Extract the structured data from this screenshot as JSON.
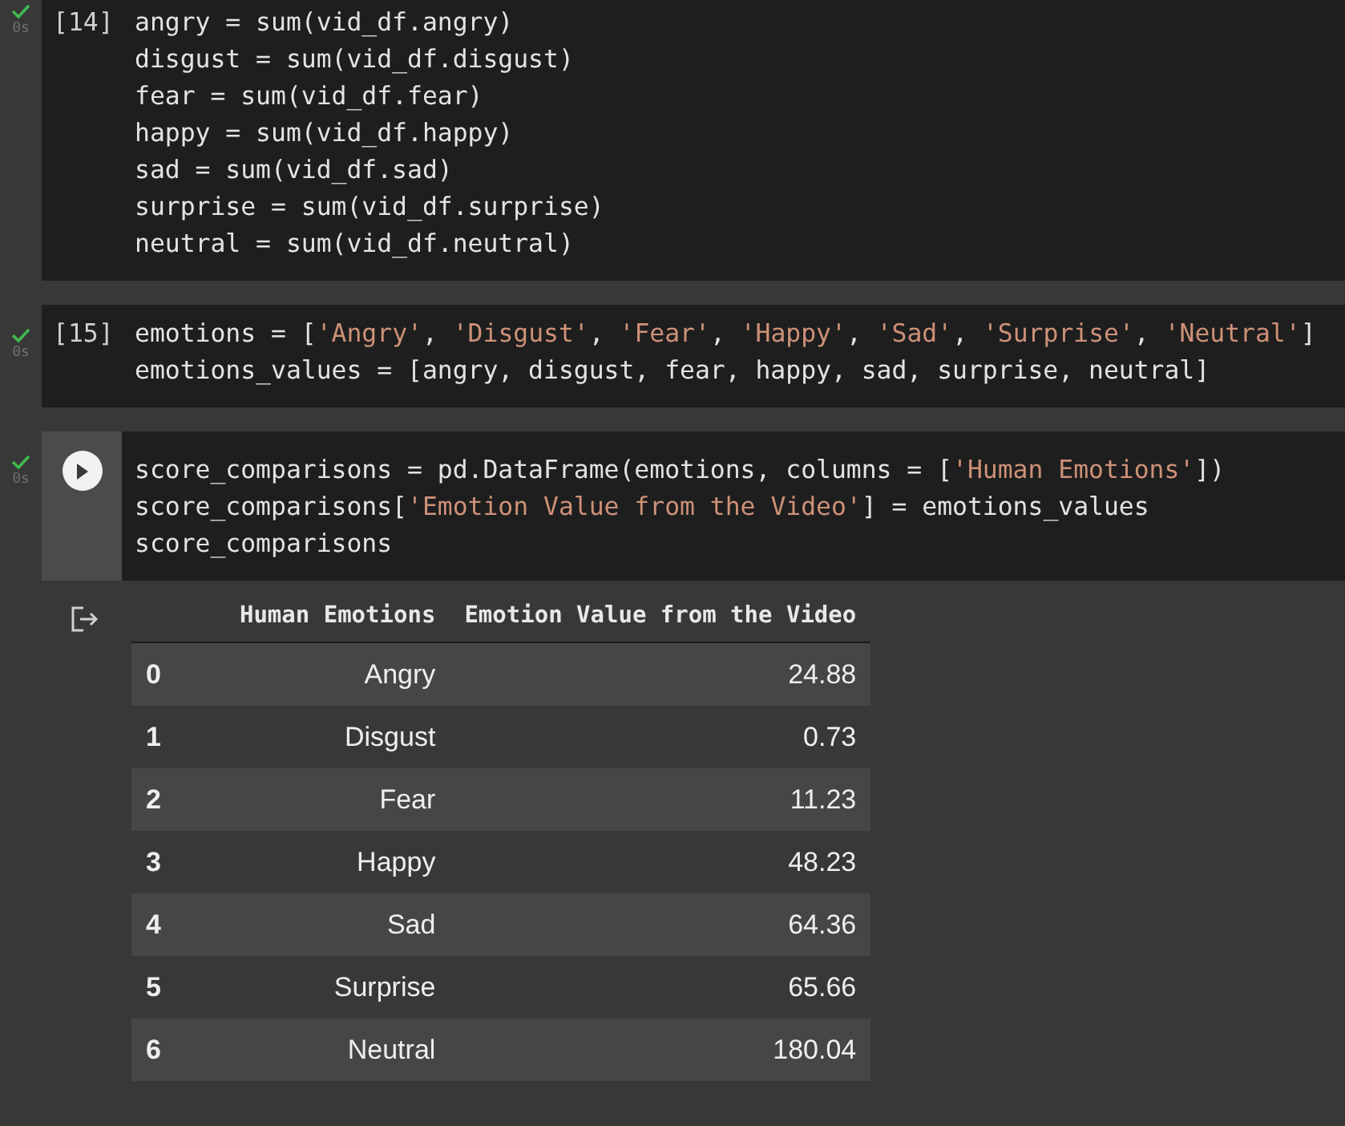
{
  "cells": [
    {
      "execution_count": "[14]",
      "exec_time": "0s",
      "focused": false,
      "lines": [
        [
          {
            "kind": "code",
            "text": "angry = sum(vid_df.angry)"
          }
        ],
        [
          {
            "kind": "code",
            "text": "disgust = sum(vid_df.disgust)"
          }
        ],
        [
          {
            "kind": "code",
            "text": "fear = sum(vid_df.fear)"
          }
        ],
        [
          {
            "kind": "code",
            "text": "happy = sum(vid_df.happy)"
          }
        ],
        [
          {
            "kind": "code",
            "text": "sad = sum(vid_df.sad)"
          }
        ],
        [
          {
            "kind": "code",
            "text": "surprise = sum(vid_df.surprise)"
          }
        ],
        [
          {
            "kind": "code",
            "text": "neutral = sum(vid_df.neutral)"
          }
        ]
      ]
    },
    {
      "execution_count": "[15]",
      "exec_time": "0s",
      "focused": false,
      "lines": [
        [
          {
            "kind": "code",
            "text": "emotions = ["
          },
          {
            "kind": "string",
            "text": "'Angry'"
          },
          {
            "kind": "code",
            "text": ", "
          },
          {
            "kind": "string",
            "text": "'Disgust'"
          },
          {
            "kind": "code",
            "text": ", "
          },
          {
            "kind": "string",
            "text": "'Fear'"
          },
          {
            "kind": "code",
            "text": ", "
          },
          {
            "kind": "string",
            "text": "'Happy'"
          },
          {
            "kind": "code",
            "text": ", "
          },
          {
            "kind": "string",
            "text": "'Sad'"
          },
          {
            "kind": "code",
            "text": ", "
          },
          {
            "kind": "string",
            "text": "'Surprise'"
          },
          {
            "kind": "code",
            "text": ", "
          },
          {
            "kind": "string",
            "text": "'Neutral'"
          },
          {
            "kind": "code",
            "text": "]"
          }
        ],
        [
          {
            "kind": "code",
            "text": "emotions_values = [angry, disgust, fear, happy, sad, surprise, neutral]"
          }
        ]
      ]
    },
    {
      "exec_time": "0s",
      "focused": true,
      "lines": [
        [
          {
            "kind": "code",
            "text": "score_comparisons = pd.DataFrame(emotions, columns = ["
          },
          {
            "kind": "string",
            "text": "'Human Emotions'"
          },
          {
            "kind": "code",
            "text": "])"
          }
        ],
        [
          {
            "kind": "code",
            "text": "score_comparisons["
          },
          {
            "kind": "string",
            "text": "'Emotion Value from the Video'"
          },
          {
            "kind": "code",
            "text": "] = emotions_values"
          }
        ],
        [
          {
            "kind": "code",
            "text": "score_comparisons"
          }
        ]
      ],
      "output": {
        "table": {
          "columns": [
            "Human Emotions",
            "Emotion Value from the Video"
          ],
          "rows": [
            {
              "index": "0",
              "cells": [
                "Angry",
                "24.88"
              ]
            },
            {
              "index": "1",
              "cells": [
                "Disgust",
                "0.73"
              ]
            },
            {
              "index": "2",
              "cells": [
                "Fear",
                "11.23"
              ]
            },
            {
              "index": "3",
              "cells": [
                "Happy",
                "48.23"
              ]
            },
            {
              "index": "4",
              "cells": [
                "Sad",
                "64.36"
              ]
            },
            {
              "index": "5",
              "cells": [
                "Surprise",
                "65.66"
              ]
            },
            {
              "index": "6",
              "cells": [
                "Neutral",
                "180.04"
              ]
            }
          ]
        }
      }
    }
  ]
}
